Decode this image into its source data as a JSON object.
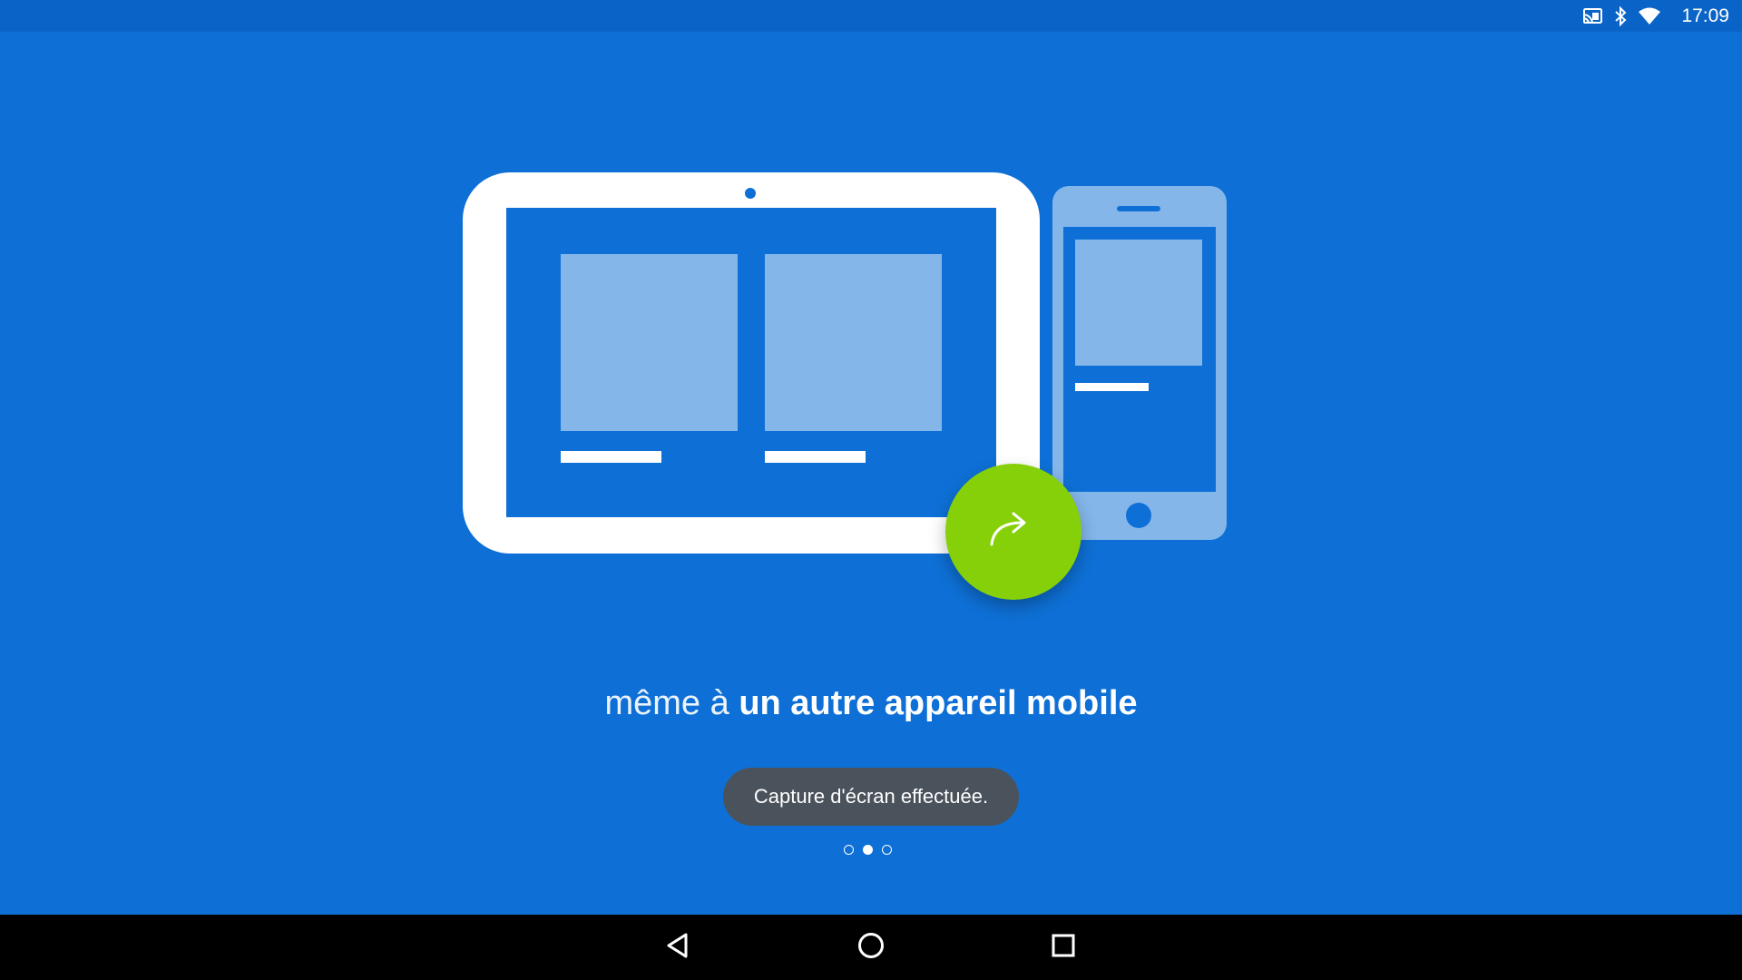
{
  "status_bar": {
    "time": "17:09",
    "icons": [
      "cast-icon",
      "bluetooth-icon",
      "wifi-icon"
    ]
  },
  "onboarding": {
    "caption_light": "même à",
    "caption_bold": "un autre appareil mobile",
    "pager": {
      "total": 3,
      "active_index": 1
    }
  },
  "toast": {
    "text": "Capture d'écran effectuée."
  },
  "nav_bar": {
    "buttons": [
      "back-icon",
      "home-icon",
      "recents-icon"
    ]
  },
  "colors": {
    "background": "#0e70d6",
    "status_bar": "#0a64c8",
    "share_button": "#86d00a",
    "toast": "#4a525c",
    "tile": "#84b6ea"
  }
}
